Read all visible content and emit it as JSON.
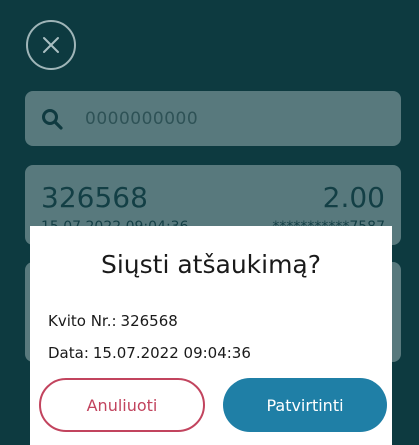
{
  "icons": {
    "close": "close-icon",
    "search": "search-icon"
  },
  "search": {
    "placeholder": "0000000000"
  },
  "receipt": {
    "number": "326568",
    "amount": "2.00",
    "datetime": "15.07.2022 09:04:36",
    "card_masked": "***********7587"
  },
  "dialog": {
    "title": "Siųsti atšaukimą?",
    "receipt_label": "Kvito Nr.:",
    "receipt_value": "326568",
    "date_label": "Data:",
    "date_value": "15.07.2022 09:04:36",
    "cancel_label": "Anuliuoti",
    "confirm_label": "Patvirtinti"
  },
  "colors": {
    "background": "#0d3a40",
    "card": "#58797d",
    "cancel": "#c2445e",
    "confirm": "#1f7fa6"
  }
}
